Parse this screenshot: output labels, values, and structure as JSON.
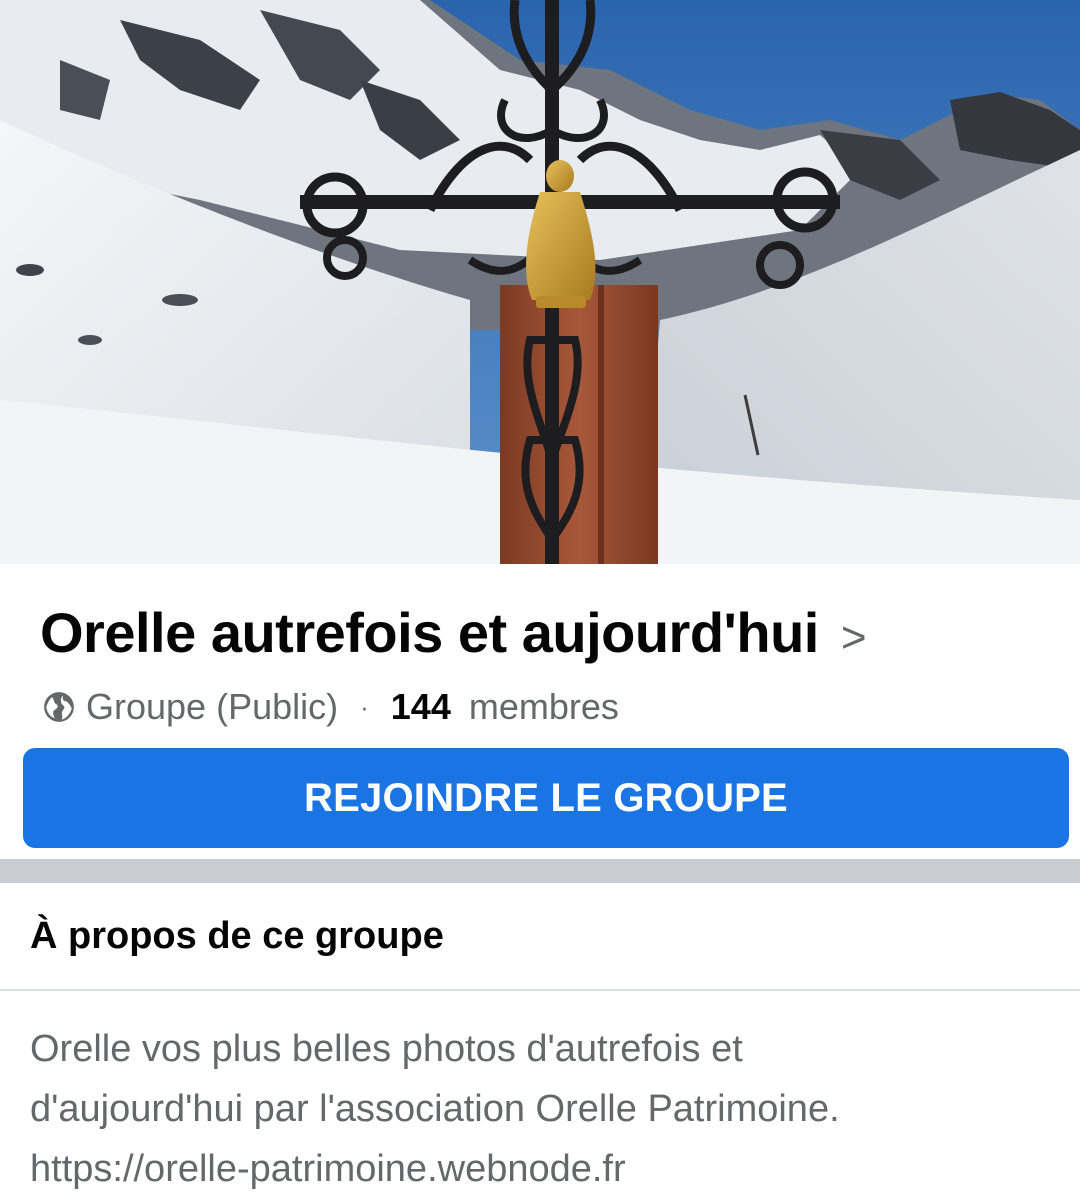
{
  "cover_photo": {
    "description_icon": "cover-photo",
    "colors": {
      "sky": "#2f6fb6",
      "snow": "#eef2f5",
      "rock": "#3a3d44",
      "wood": "#9a4b2d",
      "gold": "#c8962e"
    }
  },
  "group": {
    "title": "Orelle autrefois et aujourd'hui",
    "chevron": ">",
    "privacy": "Groupe (Public)",
    "separator": "·",
    "member_count": "144",
    "member_label": "membres",
    "join_label": "REJOINDRE LE GROUPE",
    "accent_color": "#1b74e4"
  },
  "about": {
    "heading": "À propos de ce groupe",
    "lines": [
      "Orelle vos plus belles photos d'autrefois et",
      "d'aujourd'hui par l'association Orelle Patrimoine.",
      "https://orelle-patrimoine.webnode.fr"
    ]
  }
}
